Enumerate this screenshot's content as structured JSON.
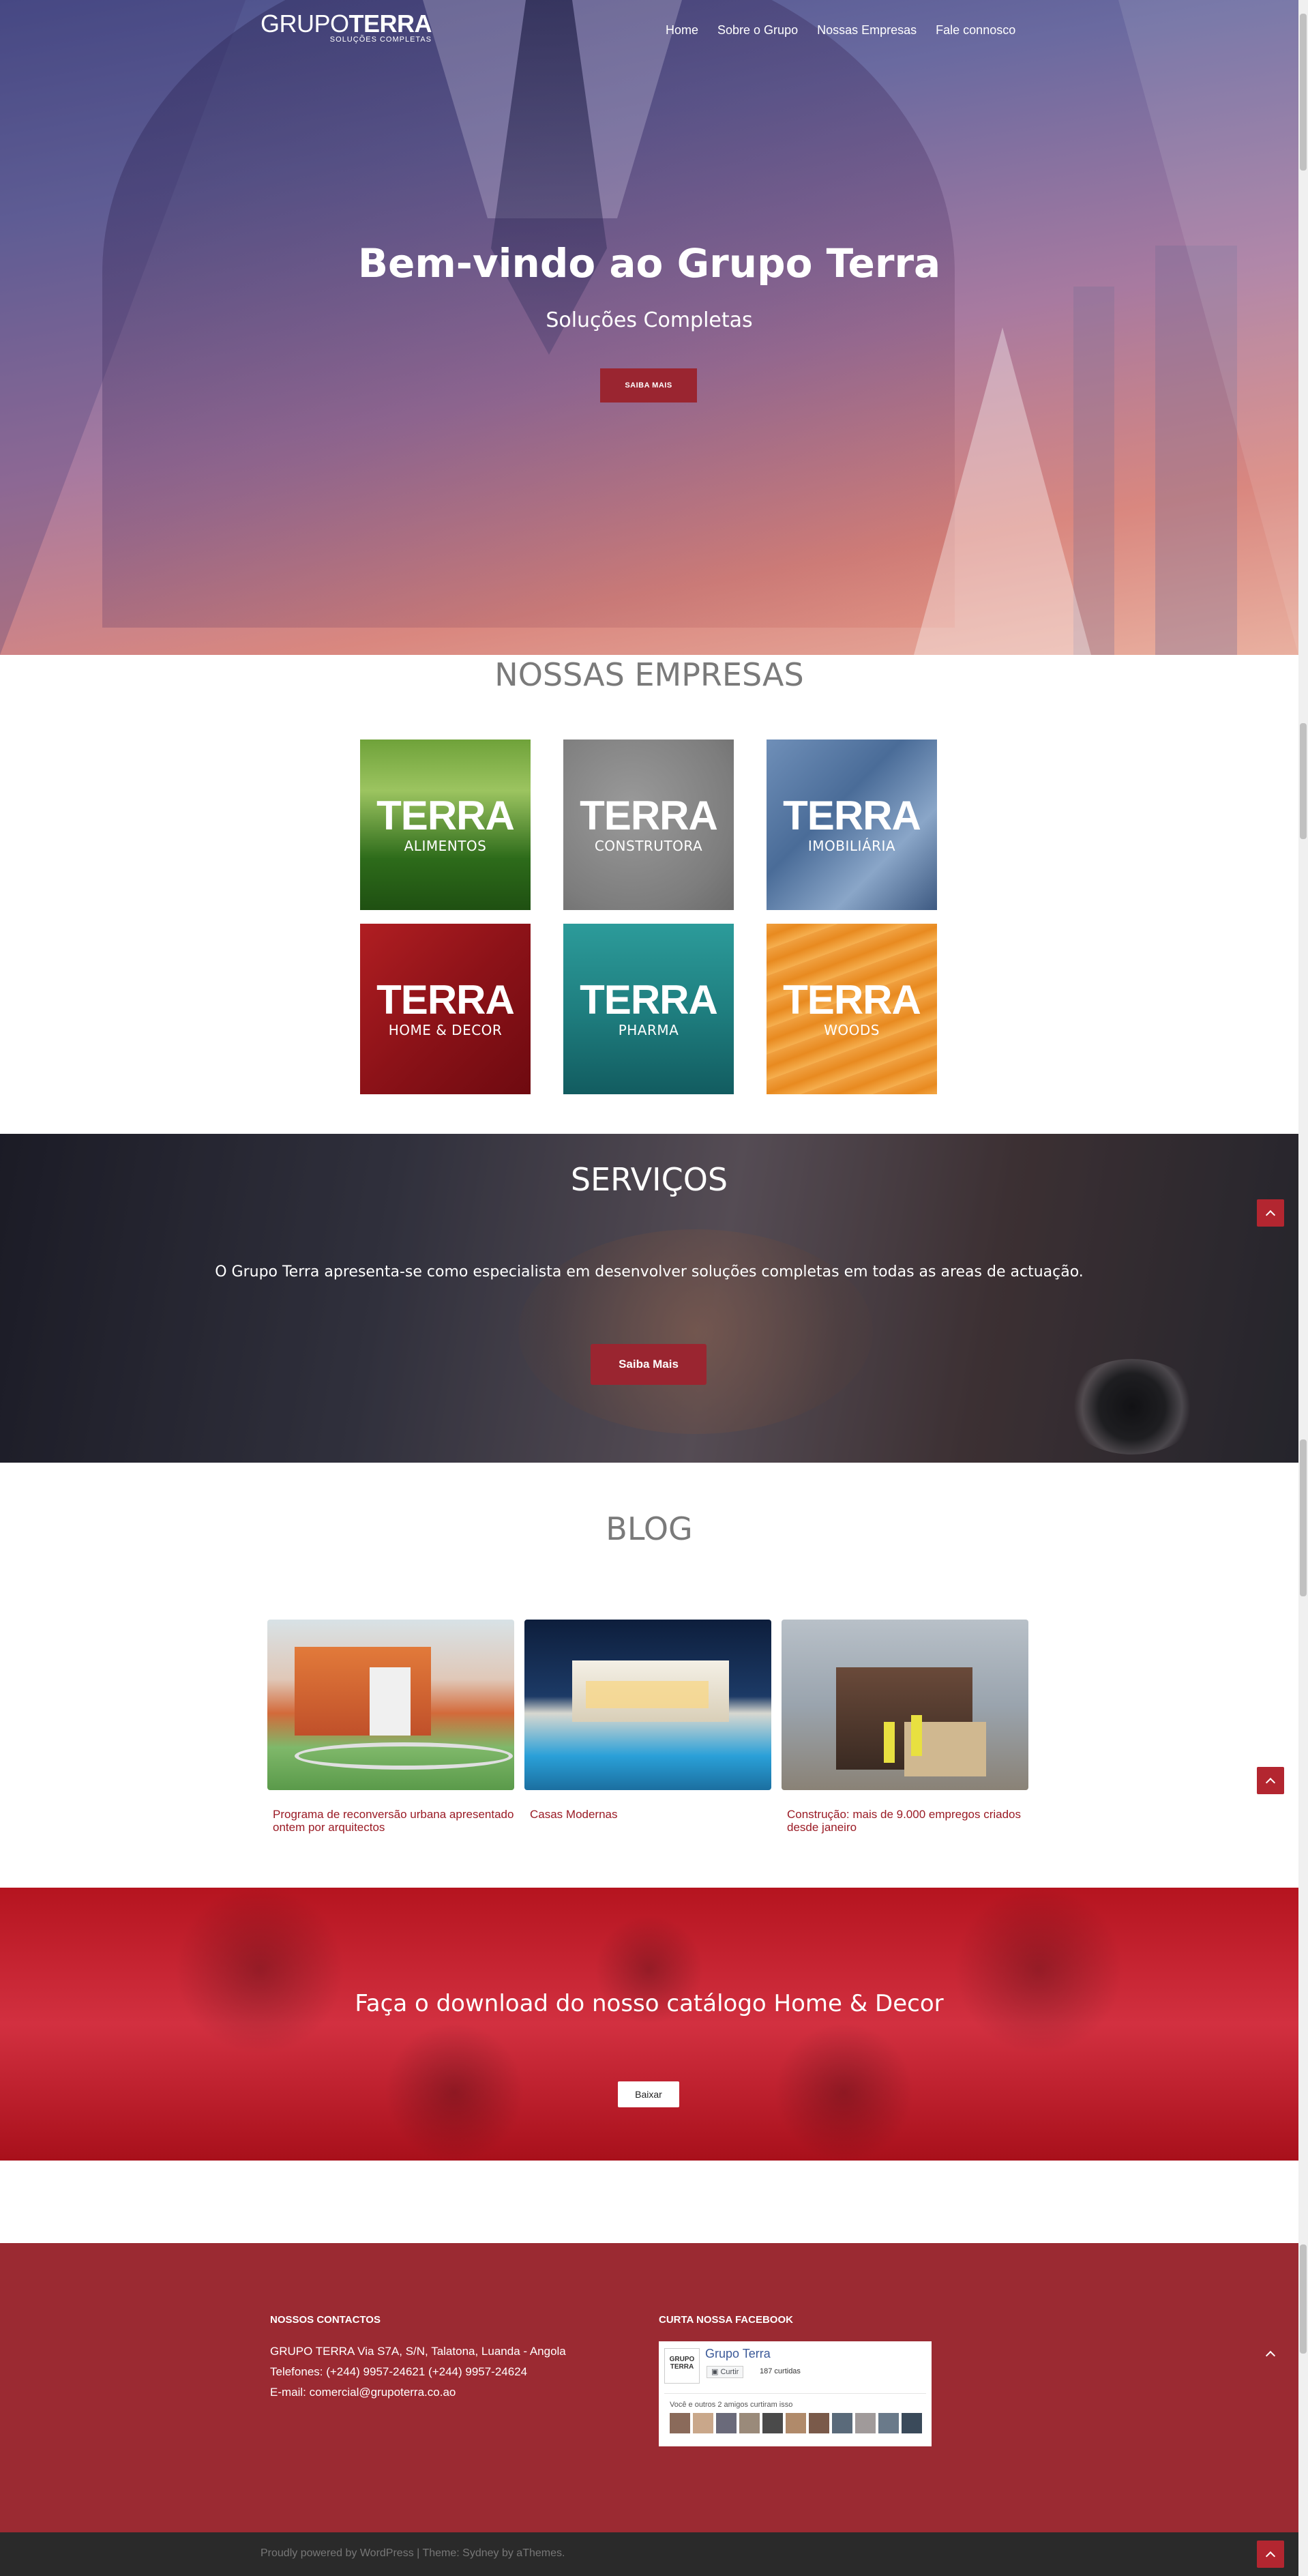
{
  "logo": {
    "line1": "GRUPO",
    "line2": "TERRA",
    "tagline": "SOLUÇÕES COMPLETAS"
  },
  "nav": {
    "items": [
      "Home",
      "Sobre o Grupo",
      "Nossas Empresas",
      "Fale connosco"
    ]
  },
  "hero": {
    "title": "Bem-vindo ao Grupo Terra",
    "subtitle": "Soluções Completas",
    "button": "SAIBA MAIS"
  },
  "companies": {
    "title": "NOSSAS EMPRESAS",
    "tiles": [
      {
        "brand": "TERRA",
        "sub": "ALIMENTOS"
      },
      {
        "brand": "TERRA",
        "sub": "CONSTRUTORA"
      },
      {
        "brand": "TERRA",
        "sub": "IMOBILIÁRIA"
      },
      {
        "brand": "TERRA",
        "sub": "HOME & DECOR"
      },
      {
        "brand": "TERRA",
        "sub": "PHARMA"
      },
      {
        "brand": "TERRA",
        "sub": "WOODS"
      }
    ]
  },
  "services": {
    "title": "SERVIÇOS",
    "text": "O Grupo Terra apresenta-se como especialista em desenvolver soluções completas em todas as areas de actuação.",
    "button": "Saiba Mais"
  },
  "blog": {
    "title": "BLOG",
    "posts": [
      {
        "title": "Programa de reconversão urbana apresentado ontem por arquitectos"
      },
      {
        "title": "Casas Modernas"
      },
      {
        "title": "Construção: mais de 9.000 empregos criados desde janeiro"
      }
    ]
  },
  "download": {
    "title": "Faça o download do nosso catálogo Home & Decor",
    "button": "Baixar"
  },
  "footer": {
    "contacts_title": "NOSSOS CONTACTOS",
    "address": "GRUPO TERRA Via S7A, S/N, Talatona, Luanda - Angola",
    "phones": "Telefones: (+244) 9957-24621 (+244) 9957-24624",
    "email": "E-mail: comercial@grupoterra.co.ao",
    "facebook_title": "CURTA NOSSA FACEBOOK",
    "fb_page_name": "Grupo Terra",
    "fb_like_label": "Curtir",
    "fb_like_count": "187 curtidas",
    "fb_friends_text": "Você e outros 2 amigos curtiram isso",
    "fb_logo_line1": "GRUPO",
    "fb_logo_line2": "TERRA"
  },
  "bottom_bar": {
    "credit": "Proudly powered by WordPress | Theme: Sydney by aThemes."
  },
  "colors": {
    "accent": "#9a2530",
    "footer_bg": "#9b2a32",
    "bottom_bar_bg": "#2a2a2a",
    "blog_link": "#9a1a24"
  },
  "icons": {
    "to_top": "chevron-up-icon",
    "fb_like": "facebook-like-icon"
  }
}
